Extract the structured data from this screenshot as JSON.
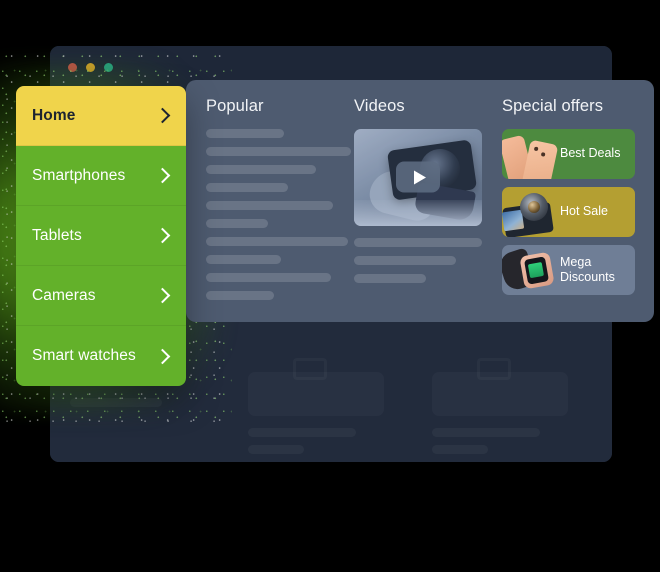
{
  "window": {
    "traffic_lights": [
      {
        "name": "close-dot",
        "color": "#c0504a"
      },
      {
        "name": "minimize-dot",
        "color": "#d3a02c"
      },
      {
        "name": "maximize-dot",
        "color": "#26a083"
      }
    ]
  },
  "sidebar": {
    "items": [
      {
        "label": "Home",
        "active": true
      },
      {
        "label": "Smartphones",
        "active": false
      },
      {
        "label": "Tablets",
        "active": false
      },
      {
        "label": "Cameras",
        "active": false
      },
      {
        "label": "Smart watches",
        "active": false
      }
    ],
    "chevron_icon": "chevron-right-icon",
    "active_color": "#f0d44b",
    "item_color": "#63b12a"
  },
  "panel": {
    "columns": {
      "popular": {
        "title": "Popular",
        "skeleton_widths": [
          78,
          145,
          110,
          82,
          127,
          62,
          142,
          75,
          125,
          68
        ]
      },
      "videos": {
        "title": "Videos",
        "thumbnail_alt": "camera-in-snow-video-thumbnail",
        "play_icon": "play-icon",
        "skeleton_widths": [
          128,
          102,
          72
        ]
      },
      "offers": {
        "title": "Special offers",
        "cards": [
          {
            "label": "Best Deals",
            "art": "smartphones-art",
            "color": "#4d8a3f"
          },
          {
            "label": "Hot Sale",
            "art": "action-camera-art",
            "color": "#b49f32"
          },
          {
            "label": "Mega\nDiscounts",
            "art": "smartwatch-art",
            "color": "#6f7e96"
          }
        ]
      }
    },
    "background_color": "#4e5b70"
  },
  "background_window": {
    "body_color": "#222b3c",
    "titlebar_color": "#1e2738"
  }
}
